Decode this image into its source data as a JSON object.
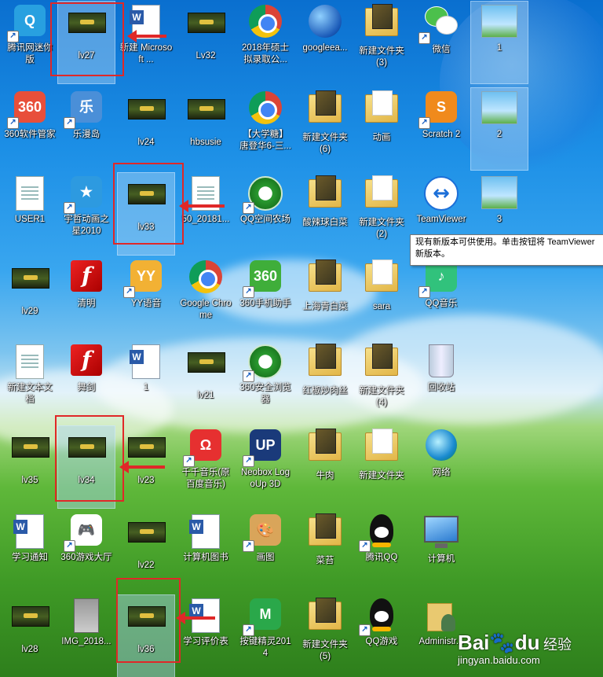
{
  "desktop_icons": [
    {
      "label": "腾讯网迷你版",
      "icon": "tencent-mini-icon",
      "style": "ic-gen",
      "color": "#28a0e0",
      "text": "Q",
      "shortcut": true
    },
    {
      "label": "lv27",
      "icon": "game-thumbnail-icon",
      "style": "ic-thumb",
      "selected": true
    },
    {
      "label": "新建 Microsoft ...",
      "icon": "word-document-icon",
      "style": "ic-word"
    },
    {
      "label": "Lv32",
      "icon": "game-thumbnail-icon",
      "style": "ic-thumb"
    },
    {
      "label": "2018年硕士拟录取公...",
      "icon": "chrome-icon",
      "style": "ic-chrome"
    },
    {
      "label": "googleea...",
      "icon": "google-earth-icon",
      "style": "ic-earth"
    },
    {
      "label": "新建文件夹 (3)",
      "icon": "folder-icon",
      "style": "ic-folder"
    },
    {
      "label": "微信",
      "icon": "wechat-icon",
      "style": "ic-wechat",
      "shortcut": true
    },
    {
      "label": "1",
      "icon": "image-tile-icon",
      "style": "ic-tile",
      "selected": true
    },
    {
      "label": "360软件管家",
      "icon": "360-software-manager-icon",
      "style": "ic-gen",
      "color": "#e84f3a",
      "text": "360",
      "shortcut": true
    },
    {
      "label": "乐漫岛",
      "icon": "lemandao-icon",
      "style": "ic-gen",
      "color": "#4a8fd8",
      "text": "乐",
      "shortcut": true
    },
    {
      "label": "lv24",
      "icon": "game-thumbnail-icon",
      "style": "ic-thumb"
    },
    {
      "label": "hbsusie",
      "icon": "game-thumbnail-icon",
      "style": "ic-thumb"
    },
    {
      "label": "【大学糖】唐登华6-三...",
      "icon": "chrome-icon",
      "style": "ic-chrome"
    },
    {
      "label": "新建文件夹 (6)",
      "icon": "folder-icon",
      "style": "ic-folder"
    },
    {
      "label": "动画",
      "icon": "folder-icon",
      "style": "ic-folder",
      "plain": true
    },
    {
      "label": "Scratch 2",
      "icon": "scratch-cat-icon",
      "style": "ic-gen",
      "color": "#f08a1c",
      "text": "S",
      "shortcut": true
    },
    {
      "label": "2",
      "icon": "image-tile-icon",
      "style": "ic-tile",
      "selected": true
    },
    {
      "label": "USER1",
      "icon": "text-document-icon",
      "style": "ic-doc"
    },
    {
      "label": "宇哲动画之星2010",
      "icon": "animation-star-icon",
      "style": "ic-gen",
      "color": "#2d9ae0",
      "text": "★",
      "shortcut": true
    },
    {
      "label": "lv33",
      "icon": "game-thumbnail-icon",
      "style": "ic-thumb",
      "selected": true
    },
    {
      "label": "50_20181...",
      "icon": "text-document-icon",
      "style": "ic-doc"
    },
    {
      "label": "QQ空间农场",
      "icon": "ie-browser-icon",
      "style": "ic-ie",
      "shortcut": true
    },
    {
      "label": "酸辣球白菜",
      "icon": "folder-icon",
      "style": "ic-folder"
    },
    {
      "label": "新建文件夹 (2)",
      "icon": "folder-icon",
      "style": "ic-folder",
      "plain": true
    },
    {
      "label": "TeamViewer",
      "icon": "teamviewer-icon",
      "style": "ic-tv",
      "text": "↔"
    },
    {
      "label": "3",
      "icon": "image-tile-icon",
      "style": "ic-tile"
    },
    {
      "label": "lv29",
      "icon": "game-thumbnail-icon",
      "style": "ic-thumb"
    },
    {
      "label": "清明",
      "icon": "flash-icon",
      "style": "ic-flash",
      "text": "f"
    },
    {
      "label": "YY语音",
      "icon": "yy-voice-icon",
      "style": "ic-gen",
      "color": "#f2b134",
      "text": "YY",
      "shortcut": true
    },
    {
      "label": "Google Chrome",
      "icon": "chrome-icon",
      "style": "ic-chrome"
    },
    {
      "label": "360手机助手",
      "icon": "360-phone-assistant-icon",
      "style": "ic-gen",
      "color": "#3fae3a",
      "text": "360",
      "shortcut": true
    },
    {
      "label": "上海青白菜",
      "icon": "folder-icon",
      "style": "ic-folder"
    },
    {
      "label": "sara",
      "icon": "folder-icon",
      "style": "ic-folder",
      "plain": true
    },
    {
      "label": "QQ音乐",
      "icon": "qq-music-icon",
      "style": "ic-gen",
      "color": "#31c27c",
      "text": "♪",
      "shortcut": true
    },
    {
      "label": "新建文本文档",
      "icon": "text-document-icon",
      "style": "ic-doc"
    },
    {
      "label": "舞剑",
      "icon": "flash-icon",
      "style": "ic-flash",
      "text": "f"
    },
    {
      "label": "1",
      "icon": "word-document-icon",
      "style": "ic-word"
    },
    {
      "label": "lv21",
      "icon": "game-thumbnail-icon",
      "style": "ic-thumb"
    },
    {
      "label": "360安全浏览器",
      "icon": "360-browser-icon",
      "style": "ic-ie",
      "shortcut": true
    },
    {
      "label": "红椒炒肉丝",
      "icon": "folder-icon",
      "style": "ic-folder"
    },
    {
      "label": "新建文件夹 (4)",
      "icon": "folder-icon",
      "style": "ic-folder"
    },
    {
      "label": "回收站",
      "icon": "recycle-bin-icon",
      "style": "ic-bin"
    },
    {
      "label": "lv35",
      "icon": "game-thumbnail-icon",
      "style": "ic-thumb"
    },
    {
      "label": "lv34",
      "icon": "game-thumbnail-icon",
      "style": "ic-thumb",
      "selected": true
    },
    {
      "label": "lv23",
      "icon": "game-thumbnail-icon",
      "style": "ic-thumb"
    },
    {
      "label": "千千音乐(原百度音乐)",
      "icon": "qianqian-music-icon",
      "style": "ic-gen",
      "color": "#e63030",
      "text": "Ω",
      "shortcut": true
    },
    {
      "label": "Neobox LogoUp 3D",
      "icon": "neobox-logoup-icon",
      "style": "ic-gen",
      "color": "#1a3a7a",
      "text": "UP",
      "shortcut": true
    },
    {
      "label": "牛肉",
      "icon": "folder-icon",
      "style": "ic-folder"
    },
    {
      "label": "新建文件夹",
      "icon": "folder-icon",
      "style": "ic-folder",
      "plain": true
    },
    {
      "label": "网络",
      "icon": "network-icon",
      "style": "ic-net"
    },
    {
      "label": "学习通知",
      "icon": "word-document-icon",
      "style": "ic-word"
    },
    {
      "label": "360游戏大厅",
      "icon": "gamepad-icon",
      "style": "ic-gen",
      "color": "#ffffff",
      "text": "🎮",
      "dark": true,
      "shortcut": true
    },
    {
      "label": "lv22",
      "icon": "game-thumbnail-icon",
      "style": "ic-thumb"
    },
    {
      "label": "计算机图书",
      "icon": "word-document-icon",
      "style": "ic-word"
    },
    {
      "label": "画图",
      "icon": "paint-palette-icon",
      "style": "ic-gen",
      "color": "#d9a55a",
      "text": "🎨",
      "shortcut": true
    },
    {
      "label": "菜苔",
      "icon": "folder-icon",
      "style": "ic-folder"
    },
    {
      "label": "腾讯QQ",
      "icon": "qq-penguin-icon",
      "style": "ic-qq",
      "shortcut": true
    },
    {
      "label": "计算机",
      "icon": "computer-icon",
      "style": "ic-pc"
    },
    {
      "label": "lv28",
      "icon": "game-thumbnail-icon",
      "style": "ic-thumb"
    },
    {
      "label": "IMG_2018...",
      "icon": "image-file-icon",
      "style": "ic-img"
    },
    {
      "label": "lv36",
      "icon": "game-thumbnail-icon",
      "style": "ic-thumb",
      "selected": true
    },
    {
      "label": "学习评价表",
      "icon": "word-document-icon",
      "style": "ic-word"
    },
    {
      "label": "按键精灵2014",
      "icon": "anjian-jingling-icon",
      "style": "ic-gen",
      "color": "#2aa84a",
      "text": "M",
      "shortcut": true
    },
    {
      "label": "新建文件夹 (5)",
      "icon": "folder-icon",
      "style": "ic-folder"
    },
    {
      "label": "QQ游戏",
      "icon": "qq-game-icon",
      "style": "ic-qq",
      "shortcut": true
    },
    {
      "label": "Administr...",
      "icon": "user-folder-icon",
      "style": "ic-user"
    }
  ],
  "tooltip": {
    "line1": "现有新版本可供使用。单击按钮将 TeamViewer",
    "line2": "新版本。"
  },
  "watermark": {
    "logo": "Bai",
    "logo2": "du",
    "cn": "经验",
    "url": "jingyan.baidu.com"
  },
  "colors": {
    "annotation_red": "#e02828",
    "label_text": "#ffffff"
  }
}
